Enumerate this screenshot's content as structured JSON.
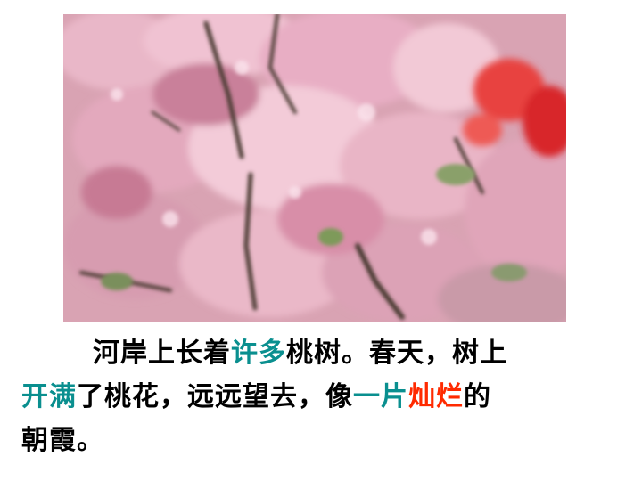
{
  "passage": {
    "line1": {
      "a": "河岸上长着",
      "b": "许多",
      "c": "桃树。春天，树上"
    },
    "line2": {
      "a": "开满",
      "b": "了桃花，远远望去，像",
      "c": "一片",
      "d": "灿烂",
      "e": "的"
    },
    "line3": {
      "a": "朝霞。"
    }
  },
  "colors": {
    "highlight_teal": "#0a8f8f",
    "highlight_red": "#ff2a00"
  }
}
